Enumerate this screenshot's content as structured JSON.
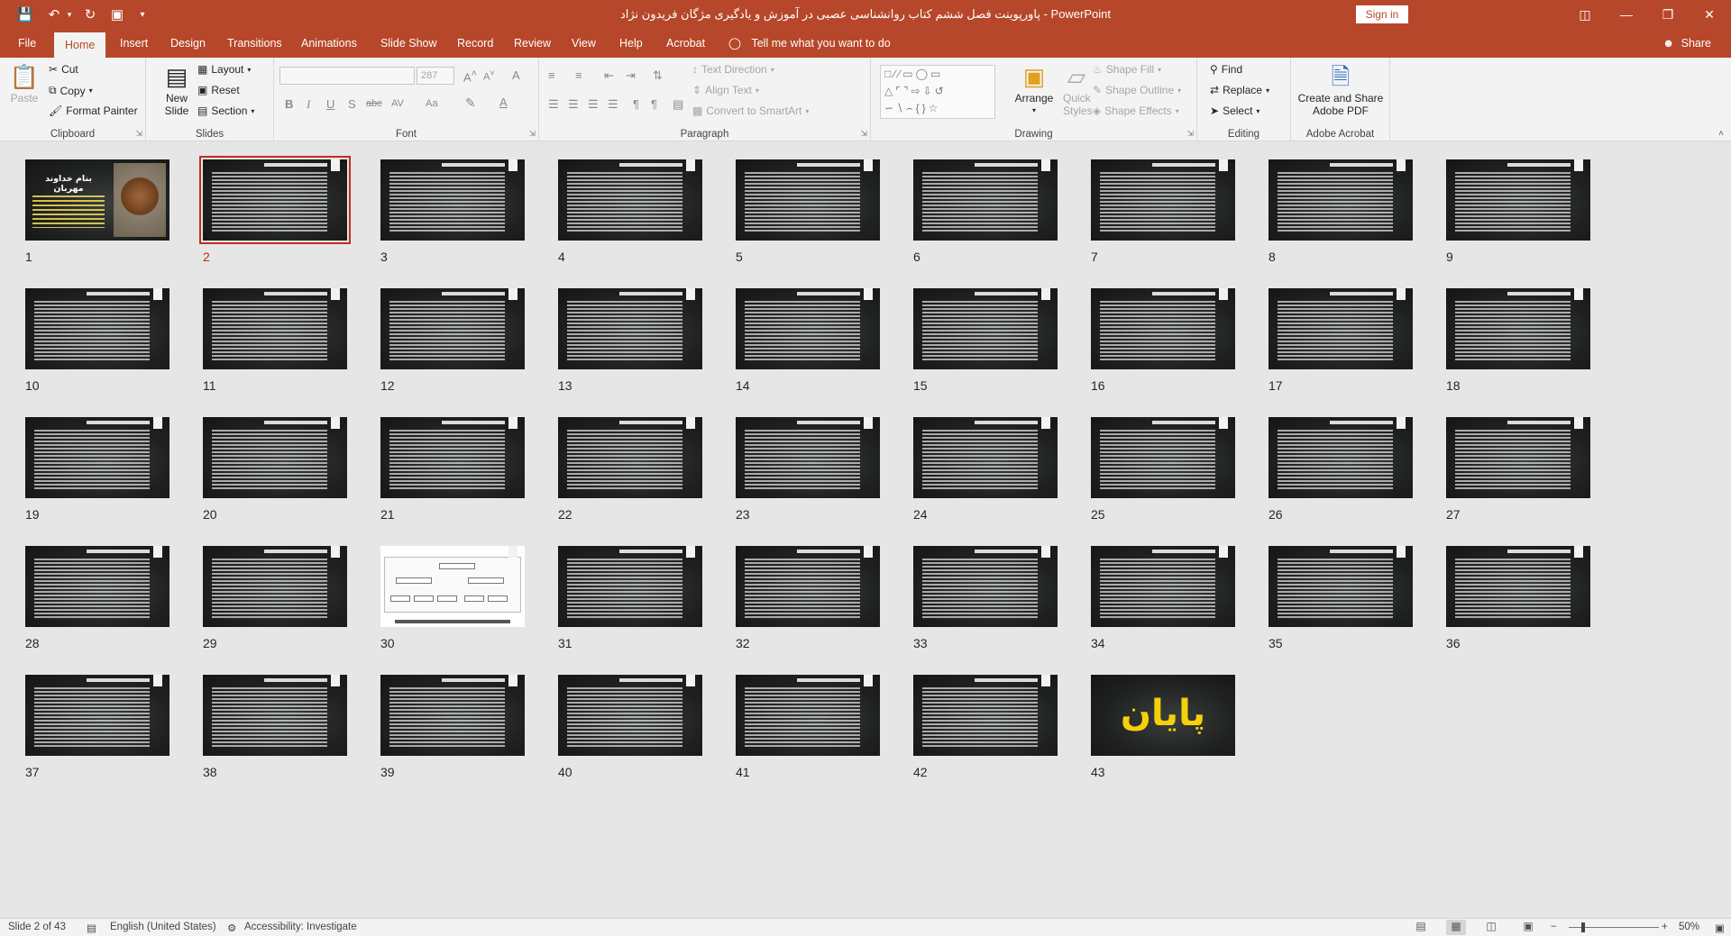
{
  "window": {
    "title": "پاورپوینت فصل ششم کتاب روانشناسی عصبی در آموزش و یادگیری مژگان فریدون نژاد  -  PowerPoint",
    "signin_label": "Sign in",
    "quick_access": [
      "save-icon",
      "undo-icon",
      "redo-icon",
      "present-icon",
      "customize-icon"
    ],
    "controls": [
      "ribbon-display-icon",
      "minimize-icon",
      "restore-icon",
      "close-icon"
    ]
  },
  "tabs": {
    "items": [
      "File",
      "Home",
      "Insert",
      "Design",
      "Transitions",
      "Animations",
      "Slide Show",
      "Record",
      "Review",
      "View",
      "Help",
      "Acrobat"
    ],
    "active": "Home",
    "tell_me": "Tell me what you want to do",
    "share": "Share"
  },
  "ribbon": {
    "clipboard": {
      "label": "Clipboard",
      "paste": "Paste",
      "cut": "Cut",
      "copy": "Copy",
      "format_painter": "Format Painter"
    },
    "slides": {
      "label": "Slides",
      "new_slide": "New Slide",
      "layout": "Layout",
      "reset": "Reset",
      "section": "Section"
    },
    "font": {
      "label": "Font",
      "font_name": "",
      "font_size": "287",
      "bold": "B",
      "italic": "I",
      "underline": "U",
      "shadow": "S",
      "strike": "abc",
      "spacing": "AV",
      "case": "Aa",
      "grow": "A",
      "shrink": "A",
      "clear": "A"
    },
    "paragraph": {
      "label": "Paragraph",
      "text_direction": "Text Direction",
      "align_text": "Align Text",
      "convert_smartart": "Convert to SmartArt"
    },
    "drawing": {
      "label": "Drawing",
      "arrange": "Arrange",
      "quick_styles": "Quick Styles",
      "shape_fill": "Shape Fill",
      "shape_outline": "Shape Outline",
      "shape_effects": "Shape Effects"
    },
    "editing": {
      "label": "Editing",
      "find": "Find",
      "replace": "Replace",
      "select": "Select"
    },
    "acrobat": {
      "label": "Adobe Acrobat",
      "create_share": "Create and Share Adobe PDF"
    }
  },
  "sorter": {
    "selected": 2,
    "slides": [
      {
        "num": "1",
        "kind": "cover",
        "title": "بنام خداوند مهربان"
      },
      {
        "num": "2",
        "kind": "text"
      },
      {
        "num": "3",
        "kind": "text"
      },
      {
        "num": "4",
        "kind": "text"
      },
      {
        "num": "5",
        "kind": "text"
      },
      {
        "num": "6",
        "kind": "text"
      },
      {
        "num": "7",
        "kind": "text"
      },
      {
        "num": "8",
        "kind": "text"
      },
      {
        "num": "9",
        "kind": "text"
      },
      {
        "num": "10",
        "kind": "text"
      },
      {
        "num": "11",
        "kind": "text"
      },
      {
        "num": "12",
        "kind": "text"
      },
      {
        "num": "13",
        "kind": "text"
      },
      {
        "num": "14",
        "kind": "text"
      },
      {
        "num": "15",
        "kind": "text"
      },
      {
        "num": "16",
        "kind": "text"
      },
      {
        "num": "17",
        "kind": "text"
      },
      {
        "num": "18",
        "kind": "text"
      },
      {
        "num": "19",
        "kind": "text"
      },
      {
        "num": "20",
        "kind": "text"
      },
      {
        "num": "21",
        "kind": "text"
      },
      {
        "num": "22",
        "kind": "text"
      },
      {
        "num": "23",
        "kind": "text"
      },
      {
        "num": "24",
        "kind": "text"
      },
      {
        "num": "25",
        "kind": "text"
      },
      {
        "num": "26",
        "kind": "text"
      },
      {
        "num": "27",
        "kind": "text"
      },
      {
        "num": "28",
        "kind": "text"
      },
      {
        "num": "29",
        "kind": "text"
      },
      {
        "num": "30",
        "kind": "diagram"
      },
      {
        "num": "31",
        "kind": "text"
      },
      {
        "num": "32",
        "kind": "text"
      },
      {
        "num": "33",
        "kind": "text"
      },
      {
        "num": "34",
        "kind": "text"
      },
      {
        "num": "35",
        "kind": "text"
      },
      {
        "num": "36",
        "kind": "text"
      },
      {
        "num": "37",
        "kind": "text"
      },
      {
        "num": "38",
        "kind": "text"
      },
      {
        "num": "39",
        "kind": "text"
      },
      {
        "num": "40",
        "kind": "text"
      },
      {
        "num": "41",
        "kind": "text"
      },
      {
        "num": "42",
        "kind": "text"
      },
      {
        "num": "43",
        "kind": "end",
        "title": "پایان"
      }
    ]
  },
  "status": {
    "slide_info": "Slide 2 of 43",
    "language": "English (United States)",
    "accessibility": "Accessibility: Investigate",
    "zoom": "50%",
    "zoom_minus": "−",
    "zoom_plus": "+"
  },
  "colors": {
    "accent": "#b7472a",
    "ribbon": "#f3f3f3",
    "selection": "#c42b1c",
    "end_text": "#f5d10a"
  }
}
